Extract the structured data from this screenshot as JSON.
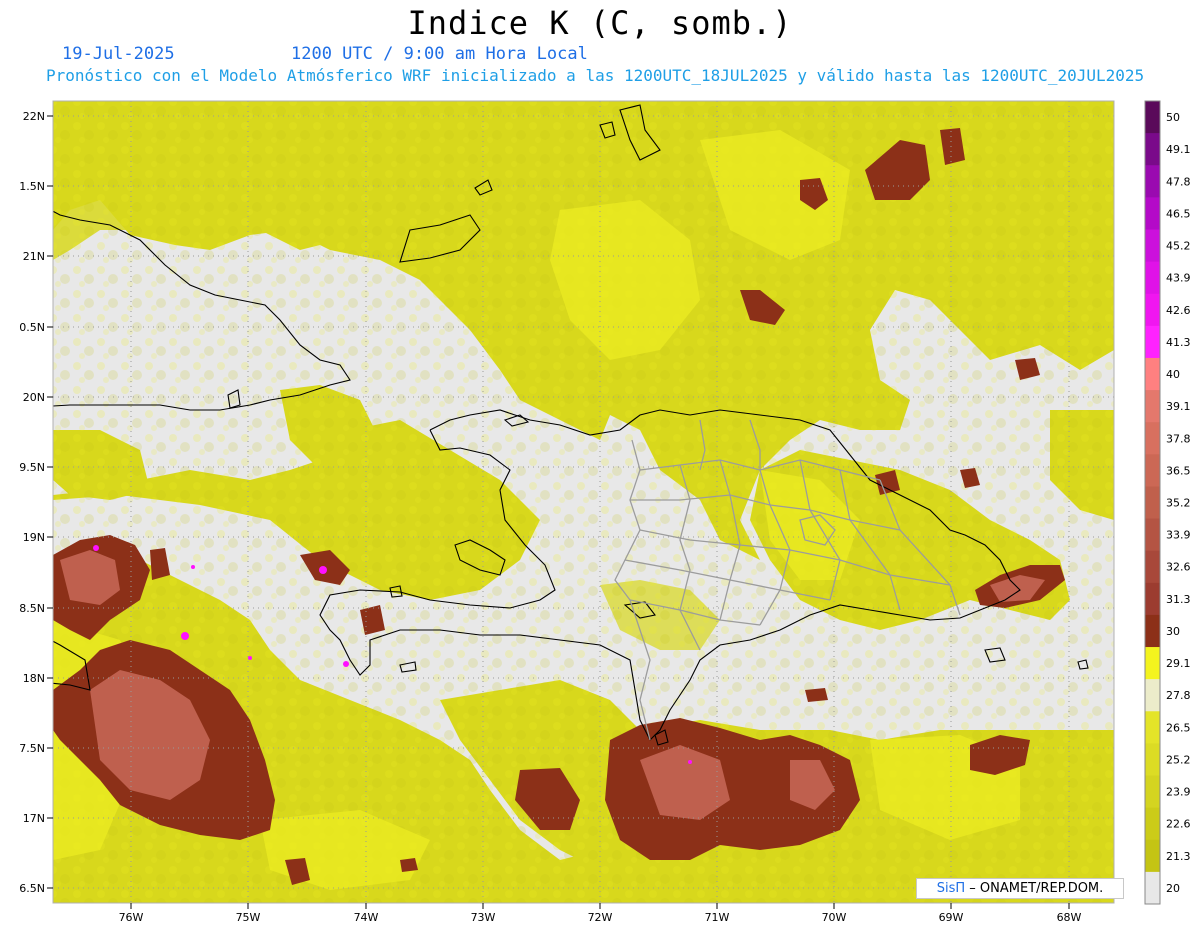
{
  "header": {
    "title": "Indice K (C, somb.)",
    "date": "19-Jul-2025",
    "time": "1200 UTC / 9:00 am Hora Local",
    "description": "Pronóstico con el Modelo Atmósferico WRF inicializado a las 1200UTC_18JUL2025 y válido hasta las  1200UTC_20JUL2025"
  },
  "map": {
    "lat_labels": [
      "22N",
      "1.5N",
      "21N",
      "0.5N",
      "20N",
      "9.5N",
      "19N",
      "8.5N",
      "18N",
      "7.5N",
      "17N",
      "6.5N"
    ],
    "lon_labels": [
      "76W",
      "75W",
      "74W",
      "73W",
      "72W",
      "71W",
      "70W",
      "69W",
      "68W"
    ],
    "colors": {
      "no_data": "#e8e8e8",
      "yellow_dark": "#c8c810",
      "yellow_mid": "#d8d81c",
      "yellow_light": "#ecec22",
      "brown": "#8c3018",
      "salmon": "#c86858",
      "magenta": "#ff10ff"
    }
  },
  "colorbar": {
    "labels": [
      "50",
      "49.1",
      "47.8",
      "46.5",
      "45.2",
      "43.9",
      "42.6",
      "41.3",
      "40",
      "39.1",
      "37.8",
      "36.5",
      "35.2",
      "33.9",
      "32.6",
      "31.3",
      "30",
      "29.1",
      "27.8",
      "26.5",
      "25.2",
      "23.9",
      "22.6",
      "21.3",
      "20"
    ],
    "colors": [
      "#5a0a5a",
      "#7a0a8a",
      "#9a0ab0",
      "#b40ac8",
      "#cc10dc",
      "#e012e8",
      "#f016f0",
      "#ff22ff",
      "#ff8080",
      "#e4786c",
      "#d8705f",
      "#cc6855",
      "#c0604c",
      "#b45443",
      "#a8483a",
      "#9c3c30",
      "#8c3018",
      "#f4f41e",
      "#ececca",
      "#e4e428",
      "#dcdc24",
      "#d4d420",
      "#cccc18",
      "#c4c414",
      "#e8e8e8"
    ]
  },
  "credit": {
    "brand": "SisΠ",
    "text": "– ONAMET/REP.DOM."
  }
}
